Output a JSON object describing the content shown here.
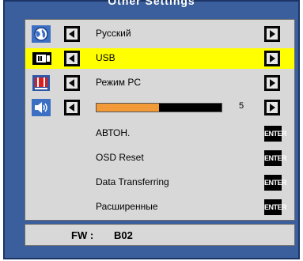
{
  "header": {
    "title": "Other Settings"
  },
  "rows": [
    {
      "label": "Русский"
    },
    {
      "label": "USB"
    },
    {
      "label": "Режим PC"
    },
    {
      "value": "5",
      "level_fraction": 0.5
    },
    {
      "label": "АВТОН.",
      "button": "ENTER"
    },
    {
      "label": "OSD Reset",
      "button": "ENTER"
    },
    {
      "label": "Data Transferring",
      "button": "ENTER"
    },
    {
      "label": "Расширенные",
      "button": "ENTER"
    }
  ],
  "footer": {
    "fw_label": "FW :",
    "fw_value": "B02"
  },
  "colors": {
    "frame": "#3a5f9c",
    "panel": "#d8d8d8",
    "selection": "#ffff00",
    "slider_fill": "#f29a38"
  },
  "icons": {
    "row0": "globe-language-icon",
    "row1": "usb-display-icon",
    "row2": "pc-mode-icon",
    "row3": "speaker-volume-icon"
  }
}
